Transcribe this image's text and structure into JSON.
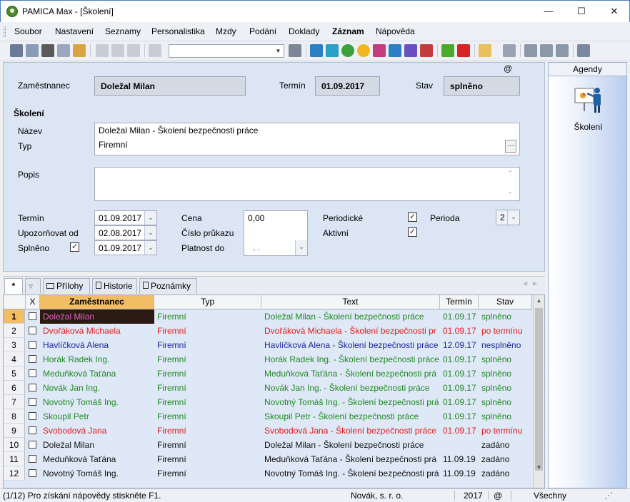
{
  "window": {
    "title": "PAMICA Max - [Školení]",
    "minimize": "—",
    "maximize": "☐",
    "close": "✕"
  },
  "menu": [
    "Soubor",
    "Nastavení",
    "Seznamy",
    "Personalistika",
    "Mzdy",
    "Podání",
    "Doklady",
    "Záznam",
    "Nápověda"
  ],
  "toolbar": {
    "filter_value": ""
  },
  "form": {
    "zamestnanec_label": "Zaměstnanec",
    "zamestnanec_value": "Doležal Milan",
    "termin_label": "Termín",
    "termin_value": "01.09.2017",
    "stav_label": "Stav",
    "stav_value": "splněno",
    "at_sign": "@",
    "section_title": "Školení",
    "nazev_label": "Název",
    "nazev_value": "Doležal Milan - Školení bezpečnosti práce",
    "typ_label": "Typ",
    "typ_value": "Firemní",
    "popis_label": "Popis",
    "popis_value": "",
    "termin2_label": "Termín",
    "termin2_value": "01.09.2017",
    "upozornovat_label": "Upozorňovat od",
    "upozornovat_value": "02.08.2017",
    "splneno_label": "Splněno",
    "splneno_checked": true,
    "splneno_value": "01.09.2017",
    "cena_label": "Cena",
    "cena_value": "0,00",
    "cislo_label": "Číslo průkazu",
    "cislo_value": "",
    "platnost_label": "Platnost do",
    "platnost_value": ". .",
    "periodicke_label": "Periodické",
    "periodicke_checked": true,
    "aktivni_label": "Aktivní",
    "aktivni_checked": true,
    "perioda_label": "Perioda",
    "perioda_value": "2"
  },
  "agendy": {
    "header": "Agendy",
    "item_label": "Školení"
  },
  "tabs": {
    "star": "*",
    "prilohy": "Přílohy",
    "historie": "Historie",
    "poznamky": "Poznámky"
  },
  "grid": {
    "columns": [
      "X",
      "Zaměstnanec",
      "Typ",
      "Text",
      "Termín",
      "Stav"
    ],
    "rows": [
      {
        "n": "1",
        "employee": "Doležal Milan",
        "type": "Firemní",
        "text": "Doležal Milan - Školení bezpečnosti práce",
        "date": "01.09.17",
        "status": "splněno",
        "color": "#1f8a1f",
        "empColor": "#e060c0",
        "dateColor": "#1f8a1f"
      },
      {
        "n": "2",
        "employee": "Dvořáková Michaela",
        "type": "Firemní",
        "text": "Dvořáková Michaela - Školení bezpečnosti pr",
        "date": "01.09.17",
        "status": "po termínu",
        "color": "#e0201c",
        "empColor": "#e0201c",
        "dateColor": "#e0201c"
      },
      {
        "n": "3",
        "employee": "Havlíčková Alena",
        "type": "Firemní",
        "text": "Havlíčková Alena - Školení bezpečnosti práce",
        "date": "12.09.17",
        "status": "nesplněno",
        "color": "#1a2a9c",
        "empColor": "#1a2a9c",
        "dateColor": "#1a2a9c"
      },
      {
        "n": "4",
        "employee": "Horák Radek Ing.",
        "type": "Firemní",
        "text": "Horák Radek Ing. - Školení bezpečnosti práce",
        "date": "01.09.17",
        "status": "splněno",
        "color": "#1f8a1f",
        "empColor": "#1f8a1f",
        "dateColor": "#1f8a1f"
      },
      {
        "n": "5",
        "employee": "Meduňková Taťána",
        "type": "Firemní",
        "text": "Meduňková Taťána - Školení bezpečnosti prá",
        "date": "01.09.17",
        "status": "splněno",
        "color": "#1f8a1f",
        "empColor": "#1f8a1f",
        "dateColor": "#1f8a1f"
      },
      {
        "n": "6",
        "employee": "Novák Jan Ing.",
        "type": "Firemní",
        "text": "Novák Jan Ing. - Školení bezpečnosti práce",
        "date": "01.09.17",
        "status": "splněno",
        "color": "#1f8a1f",
        "empColor": "#1f8a1f",
        "dateColor": "#1f8a1f"
      },
      {
        "n": "7",
        "employee": "Novotný Tomáš Ing.",
        "type": "Firemní",
        "text": "Novotný Tomáš Ing. - Školení bezpečnosti prá",
        "date": "01.09.17",
        "status": "splněno",
        "color": "#1f8a1f",
        "empColor": "#1f8a1f",
        "dateColor": "#1f8a1f"
      },
      {
        "n": "8",
        "employee": "Skoupil Petr",
        "type": "Firemní",
        "text": "Skoupil Petr - Školení bezpečnosti práce",
        "date": "01.09.17",
        "status": "splněno",
        "color": "#1f8a1f",
        "empColor": "#1f8a1f",
        "dateColor": "#1f8a1f"
      },
      {
        "n": "9",
        "employee": "Svobodová Jana",
        "type": "Firemní",
        "text": "Svobodová Jana - Školení bezpečnosti práce",
        "date": "01.09.17",
        "status": "po termínu",
        "color": "#e0201c",
        "empColor": "#e0201c",
        "dateColor": "#e0201c"
      },
      {
        "n": "10",
        "employee": "Doležal Milan",
        "type": "Firemní",
        "text": "Doležal Milan - Školení bezpečnosti práce",
        "date": "",
        "status": "zadáno",
        "color": "#111111",
        "empColor": "#111111",
        "dateColor": "#111111"
      },
      {
        "n": "11",
        "employee": "Meduňková Taťána",
        "type": "Firemní",
        "text": "Meduňková Taťána - Školení bezpečnosti prá",
        "date": "11.09.19",
        "status": "zadáno",
        "color": "#111111",
        "empColor": "#111111",
        "dateColor": "#111111"
      },
      {
        "n": "12",
        "employee": "Novotný Tomáš Ing.",
        "type": "Firemní",
        "text": "Novotný Tomáš Ing. - Školení bezpečnosti prá",
        "date": "11.09.19",
        "status": "zadáno",
        "color": "#111111",
        "empColor": "#111111",
        "dateColor": "#111111"
      }
    ]
  },
  "statusbar": {
    "hint": "(1/12) Pro získání nápovědy stiskněte F1.",
    "company": "Novák, s. r. o.",
    "year": "2017",
    "at": "@",
    "filter": "Všechny"
  }
}
